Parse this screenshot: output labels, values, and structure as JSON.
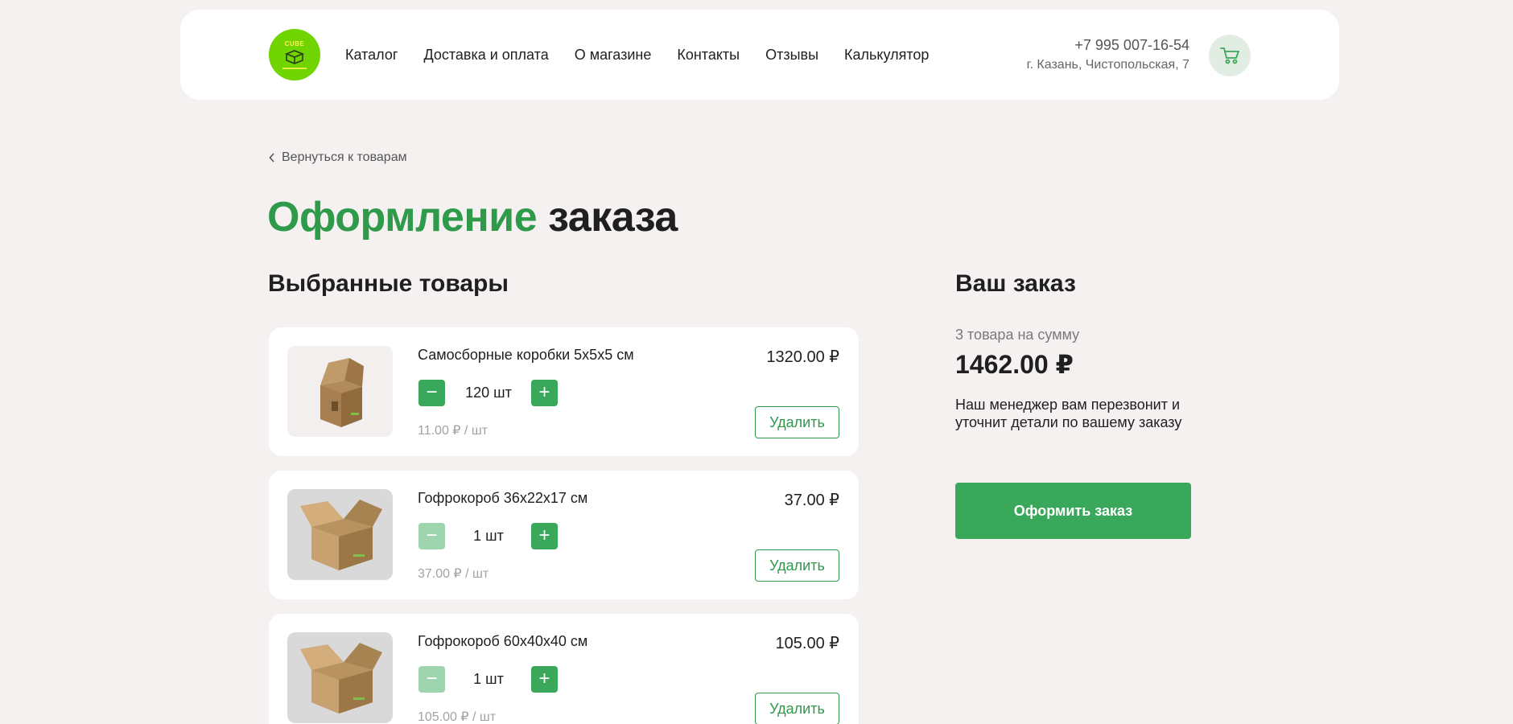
{
  "header": {
    "logo_text": "CUBE",
    "nav": [
      "Каталог",
      "Доставка и оплата",
      "О магазине",
      "Контакты",
      "Отзывы",
      "Калькулятор"
    ],
    "phone": "+7 995 007-16-54",
    "address": "г. Казань, Чистопольская, 7",
    "cart_icon": "cart-icon"
  },
  "back_link": "Вернуться к товарам",
  "page_title": {
    "accent": "Оформление",
    "rest": "заказа"
  },
  "items_title": "Выбранные товары",
  "items": [
    {
      "name": "Самосборные коробки 5х5х5 см",
      "total": "1320.00 ₽",
      "qty": "120 шт",
      "unit_price": "11.00 ₽ / шт",
      "delete_label": "Удалить",
      "minus_enabled": true
    },
    {
      "name": "Гофрокороб 36х22х17 см",
      "total": "37.00 ₽",
      "qty": "1 шт",
      "unit_price": "37.00 ₽ / шт",
      "delete_label": "Удалить",
      "minus_enabled": false
    },
    {
      "name": "Гофрокороб 60х40х40 см",
      "total": "105.00 ₽",
      "qty": "1 шт",
      "unit_price": "105.00 ₽ / шт",
      "delete_label": "Удалить",
      "minus_enabled": false
    }
  ],
  "qty_minus_symbol": "−",
  "qty_plus_symbol": "+",
  "summary": {
    "title": "Ваш заказ",
    "subtitle": "3 товара на сумму",
    "total": "1462.00 ₽",
    "note": "Наш менеджер вам перезвонит и уточнит детали по вашему заказу",
    "submit_label": "Оформить заказ"
  },
  "colors": {
    "accent": "#2e9a4a",
    "button": "#3aa85a",
    "button_disabled": "#9fd5ae",
    "logo": "#6fd400",
    "background": "#f4f1f0"
  }
}
